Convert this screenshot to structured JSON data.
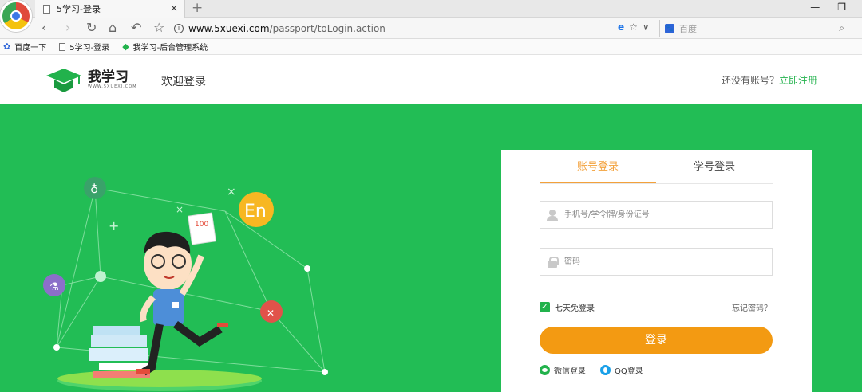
{
  "browser": {
    "tab_title": "5学习-登录",
    "tab_close": "×",
    "new_tab": "+",
    "url_main": "www.5xuexi.com",
    "url_rest": "/passport/toLogin.action",
    "search_placeholder": "百度",
    "bookmarks": [
      {
        "label": "百度一下",
        "icon": "baidu-paw-icon"
      },
      {
        "label": "5学习-登录",
        "icon": "page-icon"
      },
      {
        "label": "我学习-后台管理系统",
        "icon": "graduation-cap-icon"
      }
    ]
  },
  "header": {
    "logo_name": "我学习",
    "logo_sub": "WWW.5XUEXI.COM",
    "welcome": "欢迎登录",
    "no_account": "还没有账号？",
    "register_link": "立即注册"
  },
  "login": {
    "tabs": [
      "账号登录",
      "学号登录"
    ],
    "active_tab": 0,
    "username_placeholder": "手机号/学令牌/身份证号",
    "password_placeholder": "密码",
    "remember_label": "七天免登录",
    "remember_checked": true,
    "forgot_label": "忘记密码？",
    "submit_label": "登录",
    "wechat_label": "微信登录",
    "qq_label": "QQ登录"
  },
  "illustration": {
    "badge_en": "En",
    "paper_score": "100"
  },
  "colors": {
    "brand_green": "#22bd55",
    "accent_orange": "#f39a12",
    "tab_active": "#f3a13b"
  }
}
